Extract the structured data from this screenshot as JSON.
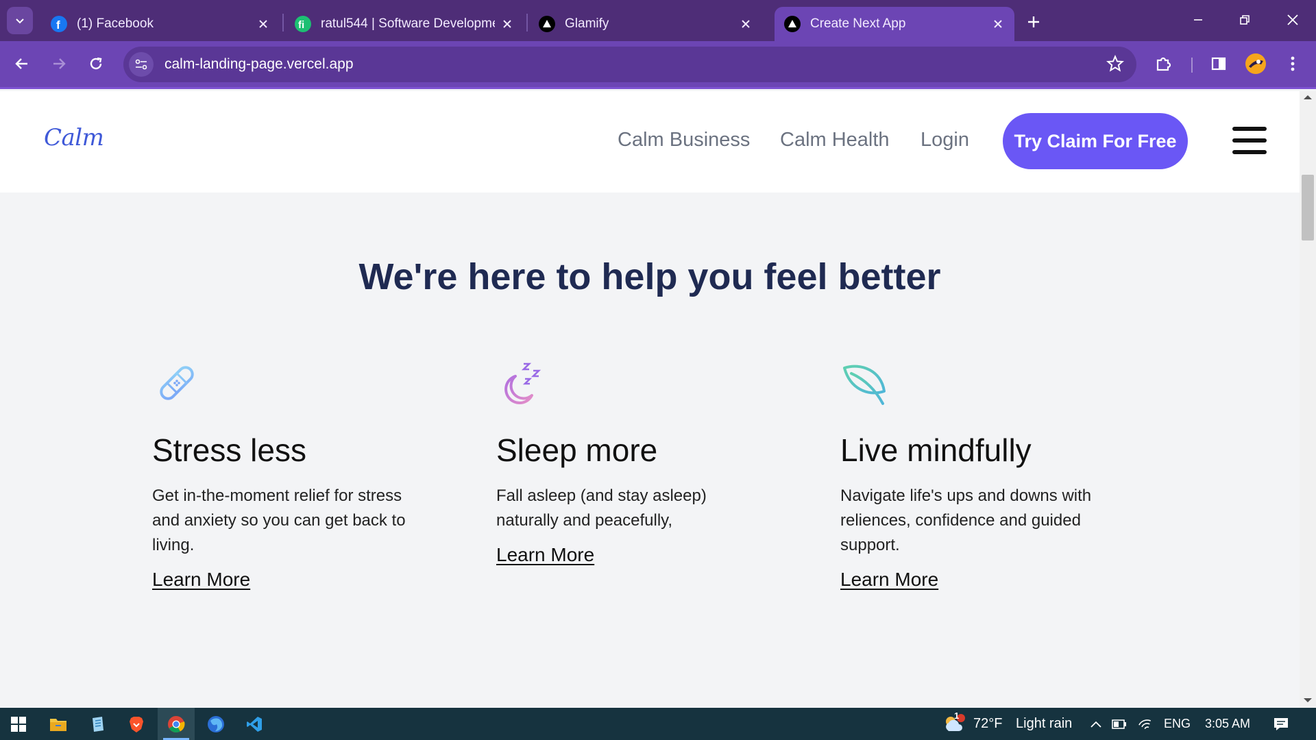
{
  "browser": {
    "tabs": [
      {
        "title": "(1) Facebook",
        "favicon": "facebook-icon",
        "active": false
      },
      {
        "title": "ratul544 | Software Developmer",
        "favicon": "fiverr-icon",
        "active": false
      },
      {
        "title": "Glamify",
        "favicon": "vercel-icon",
        "active": false
      },
      {
        "title": "Create Next App",
        "favicon": "vercel-icon",
        "active": true
      }
    ],
    "url": "calm-landing-page.vercel.app",
    "colors": {
      "tabbar": "#4e2d77",
      "toolbar": "#6c45b4"
    }
  },
  "site": {
    "logo": "Calm",
    "nav": {
      "business": "Calm Business",
      "health": "Calm Health",
      "login": "Login",
      "cta": "Try Claim For Free"
    },
    "section_title": "We're here to help you feel better",
    "features": [
      {
        "icon": "bandage-icon",
        "title": "Stress less",
        "text": "Get in-the-moment relief for stress and anxiety so you can get back to living.",
        "link": "Learn More"
      },
      {
        "icon": "moon-sleep-icon",
        "title": "Sleep more",
        "text": "Fall asleep (and stay asleep) naturally and peacefully,",
        "link": "Learn More"
      },
      {
        "icon": "leaf-icon",
        "title": "Live mindfully",
        "text": "Navigate life's ups and downs with reliences, confidence and guided support.",
        "link": "Learn More"
      }
    ],
    "colors": {
      "accent": "#6a57f5",
      "logo": "#3f59d8",
      "title": "#1f2a52"
    }
  },
  "taskbar": {
    "apps": [
      "windows-start-icon",
      "file-explorer-icon",
      "notepad-icon",
      "brave-icon",
      "chrome-icon",
      "firefox-icon",
      "vscode-icon"
    ],
    "weather": {
      "temp": "72°F",
      "condition": "Light rain",
      "badge": "1"
    },
    "language": "ENG",
    "time": "3:05 AM"
  }
}
